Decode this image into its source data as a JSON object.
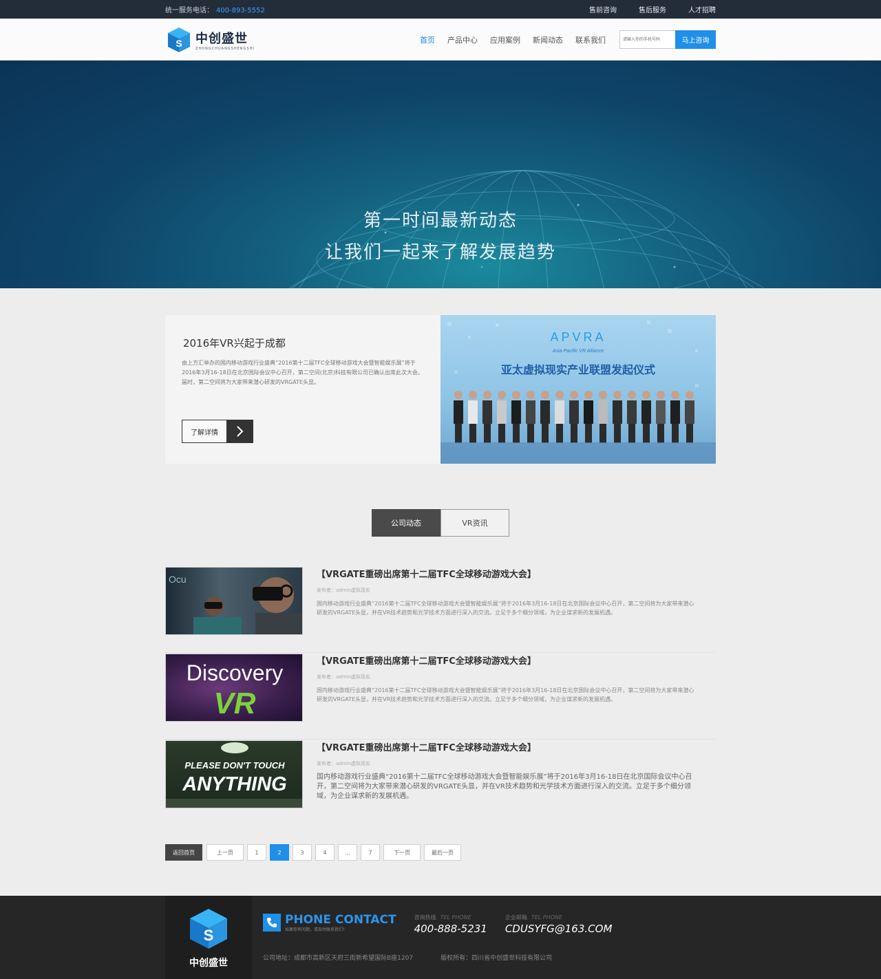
{
  "topbar": {
    "hotline_label": "统一服务电话：",
    "hotline_number": "400-893-5552",
    "links": [
      "售前咨询",
      "售后服务",
      "人才招聘"
    ]
  },
  "header": {
    "brand": "中创盛世",
    "brand_sub": "ZHONGCHUANGSHENGSHI",
    "nav": [
      "首页",
      "产品中心",
      "应用案例",
      "新闻动态",
      "联系我们"
    ],
    "search_placeholder": "请输入你的手机号码",
    "search_button": "马上咨询"
  },
  "hero": {
    "line1": "第一时间最新动态",
    "line2": "让我们一起来了解发展趋势"
  },
  "feature": {
    "title": "2016年VR兴起于成都",
    "text": "由上方汇举办的国内移动游戏行业盛典“2016第十二届TFC全球移动游戏大会暨智能娱乐展”将于2016年3月16-18日在北京国际会议中心召开，第二空间(北京)科技有限公司已确认出席此次大会。届时，第二空间将为大家带来潜心研发的VRGATE头显。",
    "more_label": "了解详情",
    "photo_brand": "APVRA",
    "photo_sub": "Asia-Pacific VR Alliance",
    "photo_title": "亚太虚拟现实产业联盟发起仪式"
  },
  "tabs": [
    "公司动态",
    "VR资讯"
  ],
  "news": [
    {
      "title": "【VRGATE重磅出席第十二届TFC全球移动游戏大会】",
      "author": "发布者：admin虚拟现实",
      "desc": "国内移动游戏行业盛典“2016第十二届TFC全球移动游戏大会暨智能娱乐展”将于2016年3月16-18日在北京国际会议中心召开，第二空间将为大家带来潜心研发的VRGATE头显，并在VR技术趋势和光学技术方面进行深入的交流。立足于多个细分领域，为企业谋求新的发展机遇。"
    },
    {
      "title": "【VRGATE重磅出席第十二届TFC全球移动游戏大会】",
      "author": "发布者：admin虚拟现实",
      "desc": "国内移动游戏行业盛典“2016第十二届TFC全球移动游戏大会暨智能娱乐展”将于2016年3月16-18日在北京国际会议中心召开，第二空间将为大家带来潜心研发的VRGATE头显，并在VR技术趋势和光学技术方面进行深入的交流。立足于多个细分领域，为企业谋求新的发展机遇。",
      "thumb_text": "Discovery",
      "thumb_text2": "VR"
    },
    {
      "title": "【VRGATE重磅出席第十二届TFC全球移动游戏大会】",
      "author": "发布者：admin虚拟现实",
      "desc": "国内移动游戏行业盛典“2016第十二届TFC全球移动游戏大会暨智能娱乐展”将于2016年3月16-18日在北京国际会议中心召开，第二空间将为大家带来潜心研发的VRGATE头显，并在VR技术趋势和光学技术方面进行深入的交流。立足于多个细分领域，为企业谋求新的发展机遇。",
      "thumb_text": "PLEASE DON'T TOUCH",
      "thumb_text2": "ANYTHING"
    }
  ],
  "pager": {
    "back": "返回首页",
    "prev": "上一页",
    "pages": [
      "1",
      "2",
      "3",
      "4",
      "...",
      "7"
    ],
    "current": "2",
    "next": "下一页",
    "last": "最后一页"
  },
  "footer": {
    "brand": "中创盛世",
    "contact_title": "PHONE CONTACT",
    "contact_sub": "如果你有问题，请及时联系我们！",
    "hotline_label": "咨询热线",
    "hotline_en": "TEL PHONE",
    "hotline": "400-888-5231",
    "email_label": "企业邮箱",
    "email_en": "TEL PHONE",
    "email": "CDUSYFG@163.COM",
    "address": "公司地址：成都市高新区天府三街新希望国际B座1207",
    "copyright": "版权所有：四川省中创盛世科技有限公司"
  },
  "colors": {
    "accent": "#1f8fe8",
    "topbar_bg": "#232d3a",
    "footer_bg": "#262626"
  }
}
